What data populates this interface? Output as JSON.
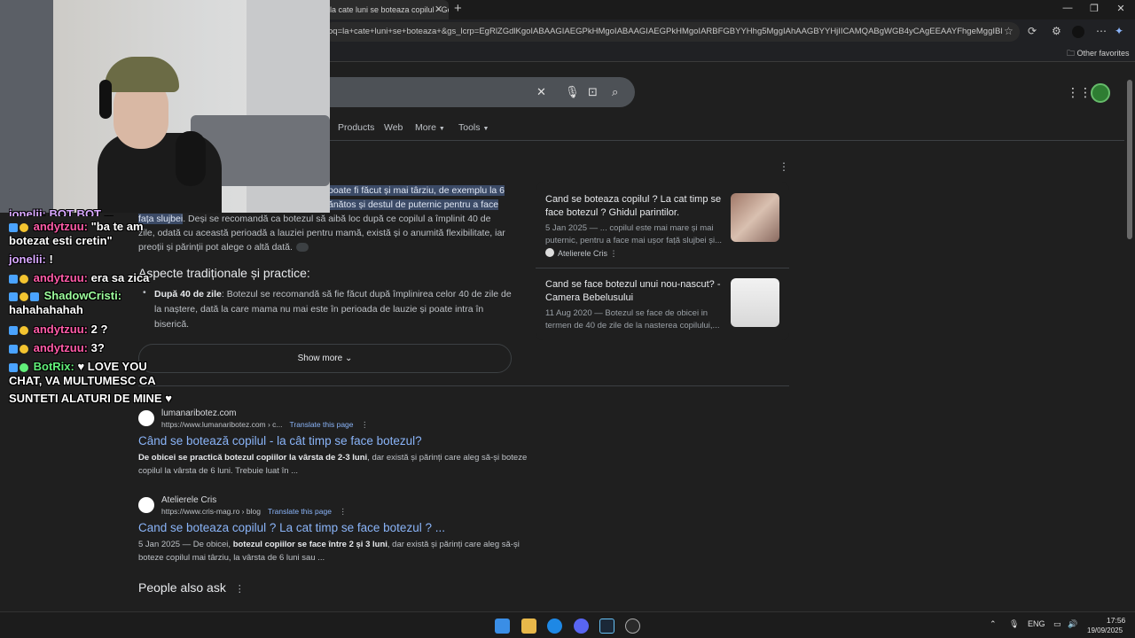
{
  "browser": {
    "tab_title": "la cate luni se boteaza copilul - Go",
    "url": "oq=la+cate+luni+se+boteaza+&gs_lcrp=EgRlZGdlKgoIABAAGIAEGPkHMgoIABAAGIAEGPkHMgoIARBFGBYYHhg5MggIAhAAGBYYHjIICAMQABgWGB4yCAgEEAAYFhgeMggIBRAAGB...",
    "other_favorites": "Other favorites"
  },
  "search": {
    "filters": [
      "Products",
      "Web",
      "More",
      "Tools"
    ]
  },
  "overview": {
    "hl_line1": "poate fi făcut și mai târziu, de exemplu la 6",
    "hl_line2": "ănătos și destul de puternic pentru a face",
    "hl_line3": "fața slujbei",
    "line3_rest": ". Deși se recomandă ca botezul să aibă loc după ce copilul a împlinit 40 de",
    "line4": "zile, odată cu această perioadă a lauziei pentru mamă, există și o anumită flexibilitate, iar",
    "line5": "preoții și părinții pot alege o altă dată.",
    "aspects_heading": "Aspecte tradiționale și practice:",
    "aspect1_bold": "După 40 de zile",
    "aspect1_text": ": Botezul se recomandă să fie făcut după împlinirea celor 40 de zile de la naștere, dată la care mama nu mai este în perioada de lauzie și poate intra în biserică.",
    "show_more": "Show more"
  },
  "cards": [
    {
      "title": "Cand se boteaza copilul ? La cat timp se face botezul ? Ghidul parintilor.",
      "snippet": "5 Jan 2025 — ... copilul este mai mare și mai puternic, pentru a face mai ușor față slujbei și...",
      "source": "Atelierele Cris"
    },
    {
      "title": "Cand se face botezul unui nou-nascut? - Camera Bebelusului",
      "snippet": "11 Aug 2020 — Botezul se face de obicei in termen de 40 de zile de la nasterea copilului,..."
    }
  ],
  "results": [
    {
      "site": "lumanaribotez.com",
      "url": "https://www.lumanaribotez.com › c...",
      "translate": "Translate this page",
      "title": "Când se botează copilul - la cât timp se face botezul?",
      "snippet_bold": "De obicei se practică botezul copiilor la vârsta de 2-3 luni",
      "snippet_rest": ", dar există și părinți care aleg să-și boteze copilul la vârsta de 6 luni. Trebuie luat în ..."
    },
    {
      "site": "Atelierele Cris",
      "url": "https://www.cris-mag.ro › blog",
      "translate": "Translate this page",
      "title": "Cand se boteaza copilul ? La cat timp se face botezul ? ...",
      "snippet_date": "5 Jan 2025 — De obicei, ",
      "snippet_bold": "botezul copiilor se face între 2 și 3 luni",
      "snippet_rest": ", dar există și părinți care aleg să-și boteze copilul mai târziu, la vârsta de 6 luni sau ..."
    }
  ],
  "people_also_ask": "People also ask",
  "chat": {
    "line0": "jonelii: BOT BOT ...",
    "line1_user": "andytzuu:",
    "line1_msg": " \"ba te am",
    "line2": "botezat esti cretin\"",
    "line3_user": "jonelii:",
    "line3_msg": " !",
    "line4_user": "andytzuu:",
    "line4_msg": " era sa zica",
    "line5_user": "ShadowCristi:",
    "line6": "hahahahahah",
    "line7_user": "andytzuu:",
    "line7_msg": " 2 ?",
    "line8_user": "andytzuu:",
    "line8_msg": " 3?",
    "line9_user": "BotRix:",
    "line9_msg": " ♥ LOVE YOU",
    "line10": "CHAT, VA MULTUMESC CA",
    "line11": "SUNTETI ALATURI DE MINE ♥"
  },
  "taskbar": {
    "lang": "ENG",
    "time": "17:56",
    "date": "19/09/2025"
  }
}
